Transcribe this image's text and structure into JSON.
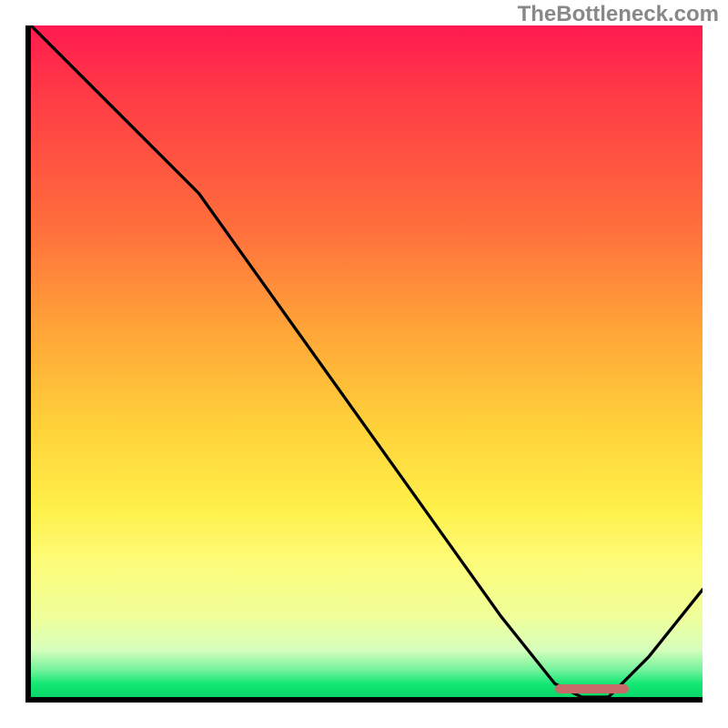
{
  "watermark": "TheBottleneck.com",
  "chart_data": {
    "type": "line",
    "title": "",
    "xlabel": "",
    "ylabel": "",
    "xlim": [
      0,
      100
    ],
    "ylim": [
      0,
      100
    ],
    "grid": false,
    "legend": false,
    "background": {
      "type": "vertical-gradient",
      "stops": [
        {
          "pos": 0,
          "color": "#ff1a50"
        },
        {
          "pos": 30,
          "color": "#ff6e3c"
        },
        {
          "pos": 60,
          "color": "#ffd23a"
        },
        {
          "pos": 80,
          "color": "#fdfc7a"
        },
        {
          "pos": 95,
          "color": "#72f29c"
        },
        {
          "pos": 100,
          "color": "#08d768"
        }
      ]
    },
    "series": [
      {
        "name": "bottleneck-curve",
        "color": "#000000",
        "x": [
          0,
          10,
          25,
          40,
          55,
          70,
          78,
          82,
          86,
          92,
          100
        ],
        "values": [
          100,
          90,
          75,
          54,
          33,
          12,
          2,
          0,
          0,
          6,
          16
        ]
      }
    ],
    "annotations": [
      {
        "name": "optimal-range-marker",
        "type": "bar",
        "color": "#c96a6a",
        "y": 1.2,
        "x_start": 78,
        "x_end": 89,
        "height": 1.4
      }
    ]
  }
}
